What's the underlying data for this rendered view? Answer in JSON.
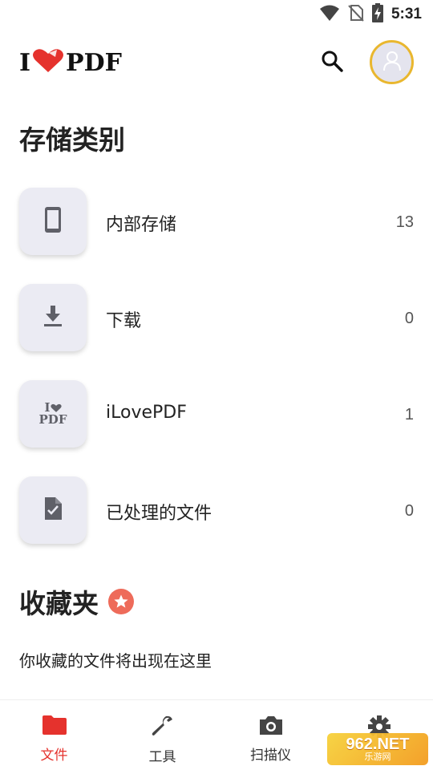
{
  "status_bar": {
    "time": "5:31",
    "icons": [
      "wifi-icon",
      "no-sim-icon",
      "battery-charging-icon"
    ]
  },
  "app_bar": {
    "logo_left": "I",
    "logo_right": "PDF",
    "search_icon": "search-icon",
    "avatar_icon": "user-icon"
  },
  "storage": {
    "title": "存储类别",
    "items": [
      {
        "label": "内部存储",
        "count": "13",
        "icon": "phone-icon"
      },
      {
        "label": "下载",
        "count": "0",
        "icon": "download-icon"
      },
      {
        "label": "iLovePDF",
        "count": "1",
        "icon": "ilovepdf-logo-icon",
        "icon_text_top": "I",
        "icon_text_bottom": "PDF"
      },
      {
        "label": "已处理的文件",
        "count": "0",
        "icon": "file-check-icon"
      }
    ]
  },
  "favorites": {
    "title": "收藏夹",
    "empty_text": "你收藏的文件将出现在这里",
    "star_icon": "star-icon"
  },
  "bottom_nav": {
    "items": [
      {
        "label": "文件",
        "icon": "folder-icon",
        "active": true
      },
      {
        "label": "工具",
        "icon": "wrench-icon",
        "active": false
      },
      {
        "label": "扫描仪",
        "icon": "camera-icon",
        "active": false
      },
      {
        "label": "",
        "icon": "gear-icon",
        "active": false
      }
    ]
  },
  "watermark": {
    "main": "962.NET",
    "sub": "乐游网"
  },
  "colors": {
    "brand_red": "#e5322d",
    "avatar_ring": "#e9b72f",
    "tile_bg": "#ebebf3",
    "icon_gray": "#5f6068"
  }
}
